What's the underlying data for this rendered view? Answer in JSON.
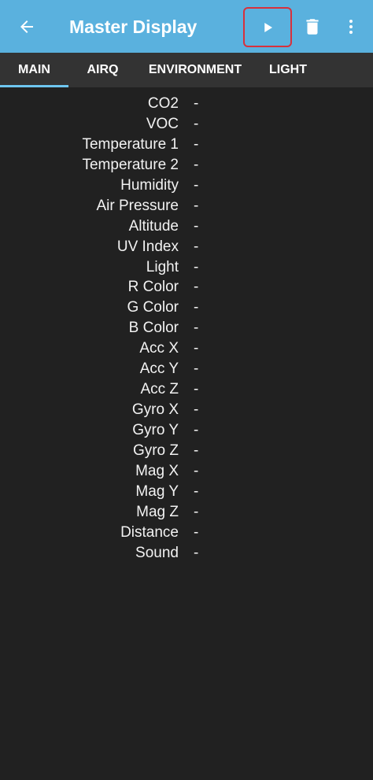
{
  "appbar": {
    "title": "Master Display",
    "icons": {
      "back": "arrow-back-icon",
      "play": "play-icon",
      "delete": "trash-icon",
      "more": "more-vertical-icon"
    },
    "color": "#5ab1de"
  },
  "tabs": [
    {
      "label": "MAIN",
      "active": true
    },
    {
      "label": "AIRQ",
      "active": false
    },
    {
      "label": "ENVIRONMENT",
      "active": false
    },
    {
      "label": "LIGHT",
      "active": false
    }
  ],
  "readings": [
    {
      "label": "CO2",
      "value": "-"
    },
    {
      "label": "VOC",
      "value": "-"
    },
    {
      "label": "Temperature 1",
      "value": "-"
    },
    {
      "label": "Temperature 2",
      "value": "-"
    },
    {
      "label": "Humidity",
      "value": "-"
    },
    {
      "label": "Air Pressure",
      "value": "-"
    },
    {
      "label": "Altitude",
      "value": "-"
    },
    {
      "label": "UV Index",
      "value": "-"
    },
    {
      "label": "Light",
      "value": "-"
    },
    {
      "label": "R Color",
      "value": "-"
    },
    {
      "label": "G Color",
      "value": "-"
    },
    {
      "label": "B Color",
      "value": "-"
    },
    {
      "label": "Acc X",
      "value": "-"
    },
    {
      "label": "Acc Y",
      "value": "-"
    },
    {
      "label": "Acc Z",
      "value": "-"
    },
    {
      "label": "Gyro X",
      "value": "-"
    },
    {
      "label": "Gyro Y",
      "value": "-"
    },
    {
      "label": "Gyro Z",
      "value": "-"
    },
    {
      "label": "Mag X",
      "value": "-"
    },
    {
      "label": "Mag Y",
      "value": "-"
    },
    {
      "label": "Mag Z",
      "value": "-"
    },
    {
      "label": "Distance",
      "value": "-"
    },
    {
      "label": "Sound",
      "value": "-"
    }
  ]
}
